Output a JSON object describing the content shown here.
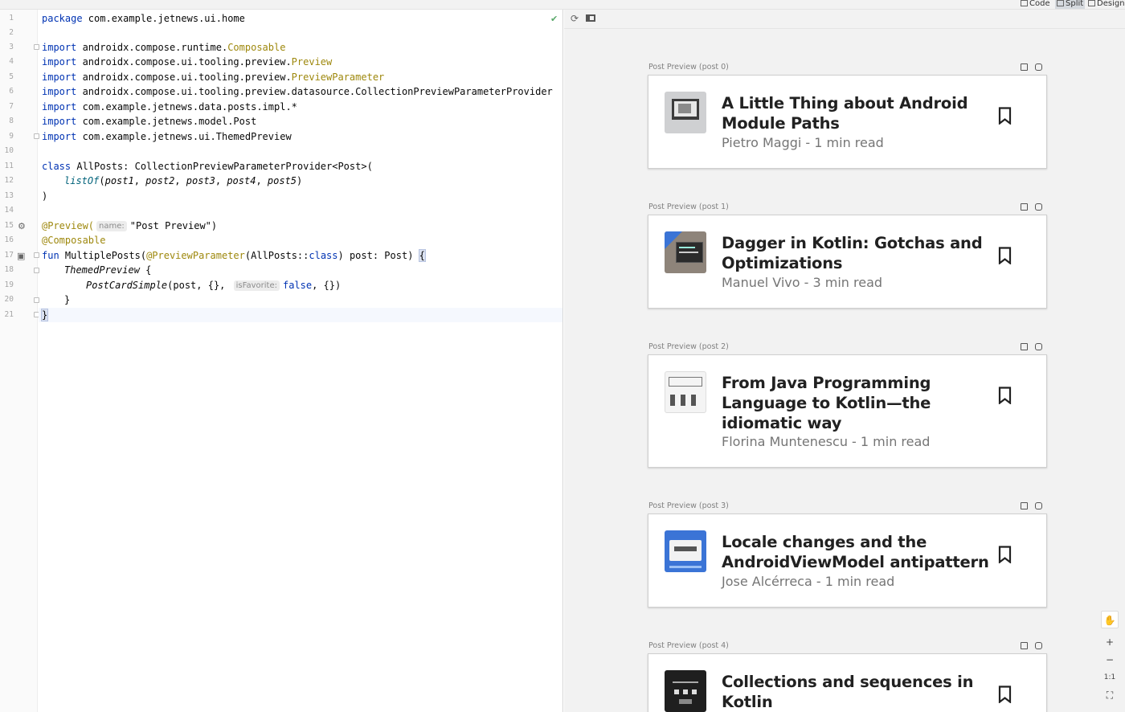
{
  "view_modes": [
    {
      "label": "Code",
      "icon": "lines-icon"
    },
    {
      "label": "Split",
      "icon": "split-icon",
      "active": true
    },
    {
      "label": "Design",
      "icon": "image-icon"
    }
  ],
  "editor": {
    "line_numbers": [
      "1",
      "2",
      "3",
      "4",
      "5",
      "6",
      "7",
      "8",
      "9",
      "10",
      "11",
      "12",
      "13",
      "14",
      "15",
      "16",
      "17",
      "18",
      "19",
      "20",
      "21"
    ],
    "lines": [
      {
        "p1": "package",
        "p2": " com.example.jetnews.ui.home"
      },
      {},
      {
        "p1": "import",
        "p2": " androidx.compose.runtime.",
        "p3": "Composable"
      },
      {
        "p1": "import",
        "p2": " androidx.compose.ui.tooling.preview.",
        "p3": "Preview"
      },
      {
        "p1": "import",
        "p2": " androidx.compose.ui.tooling.preview.",
        "p3": "PreviewParameter"
      },
      {
        "p1": "import",
        "p2": " androidx.compose.ui.tooling.preview.datasource.CollectionPreviewParameterProvider"
      },
      {
        "p1": "import",
        "p2": " com.example.jetnews.data.posts.impl.*"
      },
      {
        "p1": "import",
        "p2": " com.example.jetnews.model.Post"
      },
      {
        "p1": "import",
        "p2": " com.example.jetnews.ui.ThemedPreview"
      },
      {},
      {
        "p1": "class",
        "p2": " AllPosts: CollectionPreviewParameterProvider<Post>("
      },
      {
        "p1": "listOf",
        "p2": "(",
        "p3": "post1",
        "p4": ", ",
        "p5": "post2",
        "p6": ", ",
        "p7": "post3",
        "p8": ", ",
        "p9": "post4",
        "p10": ", ",
        "p11": "post5",
        "p12": ")"
      },
      {
        "p1": ")"
      },
      {},
      {
        "p1": "@Preview(",
        "hint": "name:",
        "p2": "\"Post Preview\")"
      },
      {
        "p1": "@Composable"
      },
      {
        "p1": "fun",
        "p2": " MultiplePosts(",
        "p3": "@PreviewParameter",
        "p4": "(AllPosts::",
        "p5": "class",
        "p6": ") post: Post) ",
        "p7": "{"
      },
      {
        "p1": "ThemedPreview",
        "p2": " {"
      },
      {
        "p1": "PostCardSimple",
        "p2": "(post, {}, ",
        "hint": "isFavorite:",
        "p3": "false",
        "p4": ", {})"
      },
      {
        "p1": "}"
      },
      {
        "p1": "}"
      }
    ]
  },
  "preview": {
    "toolbar": {
      "refresh_icon": "refresh-icon",
      "layout_icon": "layout-icon"
    },
    "posts": [
      {
        "caption": "Post Preview (post 0)",
        "title": "A Little Thing about Android Module Paths",
        "meta": "Pietro Maggi - 1 min read",
        "thumb": "folder-laptop-thumb"
      },
      {
        "caption": "Post Preview (post 1)",
        "title": "Dagger in Kotlin: Gotchas and Optimizations",
        "meta": "Manuel Vivo - 3 min read",
        "thumb": "code-screen-thumb"
      },
      {
        "caption": "Post Preview (post 2)",
        "title": "From Java Programming Language to Kotlin—the idiomatic way",
        "meta": "Florina Muntenescu - 1 min read",
        "thumb": "sketch-diagram-thumb"
      },
      {
        "caption": "Post Preview (post 3)",
        "title": "Locale changes and the AndroidViewModel antipattern",
        "meta": "Jose Alcérreca - 1 min read",
        "thumb": "android-card-thumb"
      },
      {
        "caption": "Post Preview (post 4)",
        "title": "Collections and sequences in Kotlin",
        "meta": "",
        "thumb": "dark-diagram-thumb"
      }
    ]
  },
  "zoom_controls": [
    {
      "label": "✋",
      "icon": "hand-icon"
    },
    {
      "label": "+",
      "icon": "zoom-in-icon"
    },
    {
      "label": "−",
      "icon": "zoom-out-icon"
    },
    {
      "label": "1:1",
      "icon": "actual-size-icon"
    },
    {
      "label": "⛶",
      "icon": "fit-screen-icon"
    }
  ],
  "colors": {
    "keyword": "#0033b3",
    "annotation": "#9e880d",
    "accent_thumb_blue": "#3b74d6"
  }
}
